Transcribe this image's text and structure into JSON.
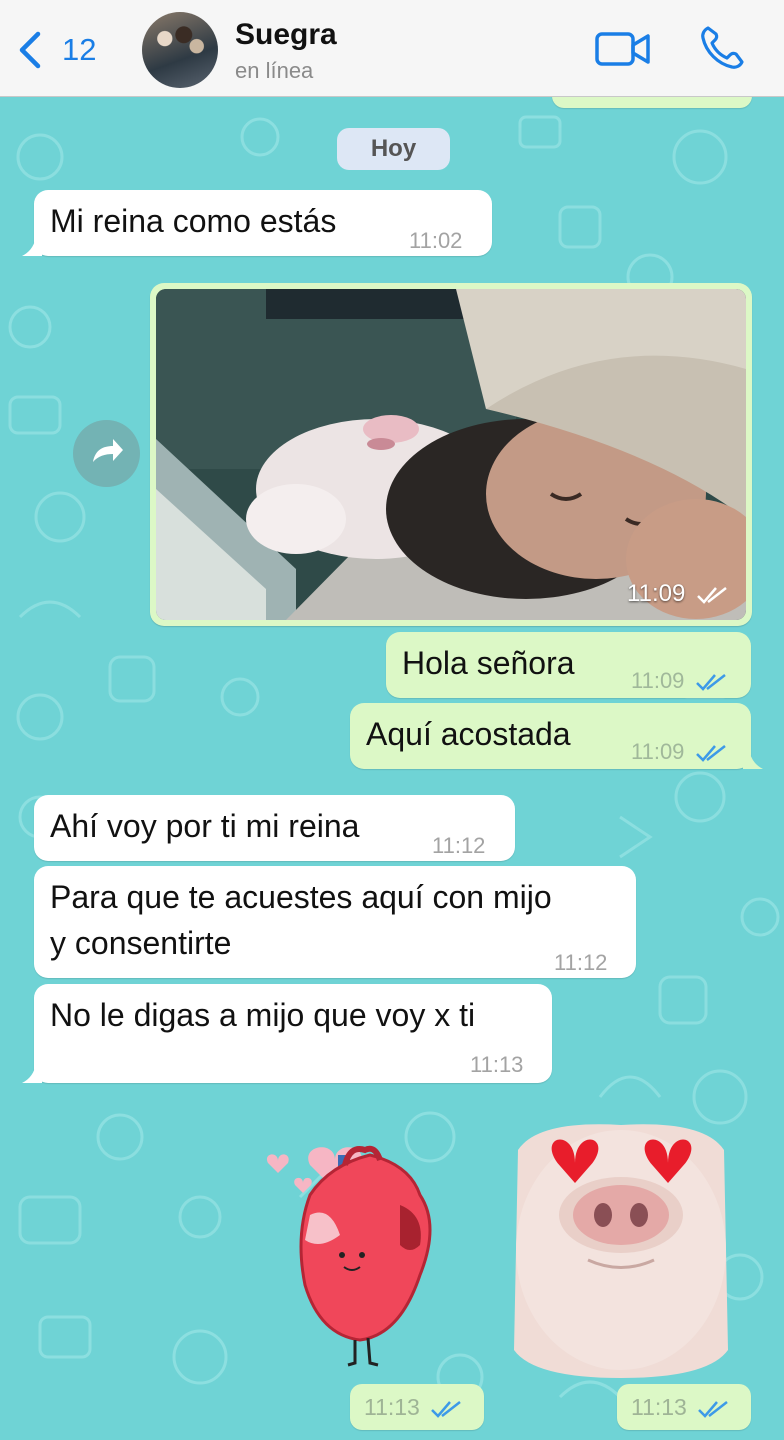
{
  "header": {
    "back_count": "12",
    "contact_name": "Suegra",
    "contact_status": "en línea"
  },
  "date_chip": "Hoy",
  "messages": [
    {
      "text": "Mi reina como estás",
      "time": "11:02"
    },
    {
      "type": "photo",
      "time": "11:09"
    },
    {
      "text": "Hola señora",
      "time": "11:09"
    },
    {
      "text": "Aquí acostada",
      "time": "11:09"
    },
    {
      "text": "Ahí voy por ti mi reina",
      "time": "11:12"
    },
    {
      "text_line1": "Para que te acuestes aquí con mijo",
      "text_line2": "y consentirte",
      "time": "11:12"
    },
    {
      "text": "No le digas a mijo que voy x ti",
      "time": "11:13"
    },
    {
      "type": "sticker",
      "time": "11:13"
    },
    {
      "type": "sticker",
      "time": "11:13"
    }
  ],
  "colors": {
    "accent": "#1a7ee6",
    "wallpaper": "#6fd3d5",
    "outgoing_bubble": "#dcf8c6",
    "incoming_bubble": "#ffffff",
    "read_ticks": "#3d9ae8"
  },
  "icons": {
    "back": "chevron-left-icon",
    "video": "video-camera-icon",
    "phone": "phone-icon",
    "forward": "forward-arrow-icon",
    "ticks": "double-check-icon"
  }
}
